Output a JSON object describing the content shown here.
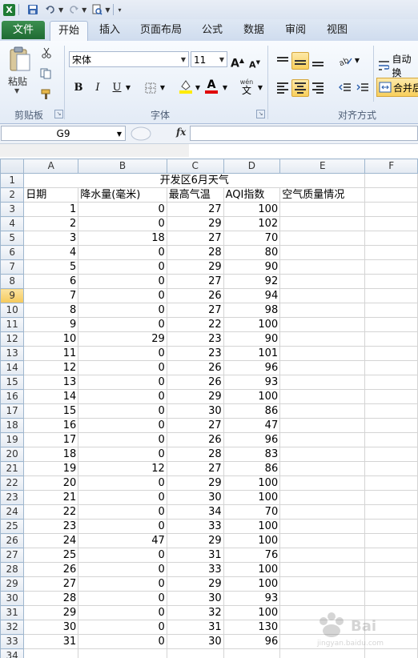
{
  "app": {
    "name_box": "G9",
    "fx_label": "fx"
  },
  "ribbon_tabs": [
    {
      "id": "file",
      "label": "文件"
    },
    {
      "id": "home",
      "label": "开始"
    },
    {
      "id": "insert",
      "label": "插入"
    },
    {
      "id": "layout",
      "label": "页面布局"
    },
    {
      "id": "formulas",
      "label": "公式"
    },
    {
      "id": "data",
      "label": "数据"
    },
    {
      "id": "review",
      "label": "审阅"
    },
    {
      "id": "view",
      "label": "视图"
    }
  ],
  "ribbon": {
    "paste_label": "粘贴",
    "clipboard_group": "剪贴板",
    "font_group": "字体",
    "alignment_group": "对齐方式",
    "font_name": "宋体",
    "font_size": "11",
    "bold": "B",
    "italic": "I",
    "underline": "U",
    "grow_font": "A",
    "shrink_font": "A",
    "font_color_letter": "A",
    "wen_label": "wén",
    "wen_char": "文",
    "auto_wrap": "自动换",
    "merge_center": "合并后"
  },
  "colors": {
    "file_tab": "#1f6b33",
    "accent_highlight": "#f8cf5c",
    "font_color": "#e00000",
    "fill_color": "#ffeb00"
  },
  "sheet": {
    "columns": [
      "A",
      "B",
      "C",
      "D",
      "E",
      "F"
    ],
    "selected_row": "9",
    "title": "开发区6月天气",
    "headers": [
      "日期",
      "降水量(毫米)",
      "最高气温",
      "AQI指数",
      "空气质量情况"
    ],
    "rows": [
      [
        "1",
        "0",
        "27",
        "100"
      ],
      [
        "2",
        "0",
        "29",
        "102"
      ],
      [
        "3",
        "18",
        "27",
        "70"
      ],
      [
        "4",
        "0",
        "28",
        "80"
      ],
      [
        "5",
        "0",
        "29",
        "90"
      ],
      [
        "6",
        "0",
        "27",
        "92"
      ],
      [
        "7",
        "0",
        "26",
        "94"
      ],
      [
        "8",
        "0",
        "27",
        "98"
      ],
      [
        "9",
        "0",
        "22",
        "100"
      ],
      [
        "10",
        "29",
        "23",
        "90"
      ],
      [
        "11",
        "0",
        "23",
        "101"
      ],
      [
        "12",
        "0",
        "26",
        "96"
      ],
      [
        "13",
        "0",
        "26",
        "93"
      ],
      [
        "14",
        "0",
        "29",
        "100"
      ],
      [
        "15",
        "0",
        "30",
        "86"
      ],
      [
        "16",
        "0",
        "27",
        "47"
      ],
      [
        "17",
        "0",
        "26",
        "96"
      ],
      [
        "18",
        "0",
        "28",
        "83"
      ],
      [
        "19",
        "12",
        "27",
        "86"
      ],
      [
        "20",
        "0",
        "29",
        "100"
      ],
      [
        "21",
        "0",
        "30",
        "100"
      ],
      [
        "22",
        "0",
        "34",
        "70"
      ],
      [
        "23",
        "0",
        "33",
        "100"
      ],
      [
        "24",
        "47",
        "29",
        "100"
      ],
      [
        "25",
        "0",
        "31",
        "76"
      ],
      [
        "26",
        "0",
        "33",
        "100"
      ],
      [
        "27",
        "0",
        "29",
        "100"
      ],
      [
        "28",
        "0",
        "30",
        "93"
      ],
      [
        "29",
        "0",
        "32",
        "100"
      ],
      [
        "30",
        "0",
        "31",
        "130"
      ],
      [
        "31",
        "0",
        "30",
        "96"
      ]
    ],
    "last_row_label": "34"
  },
  "watermark": {
    "text": "Bai",
    "sub": "jingyan.baidu.com"
  }
}
